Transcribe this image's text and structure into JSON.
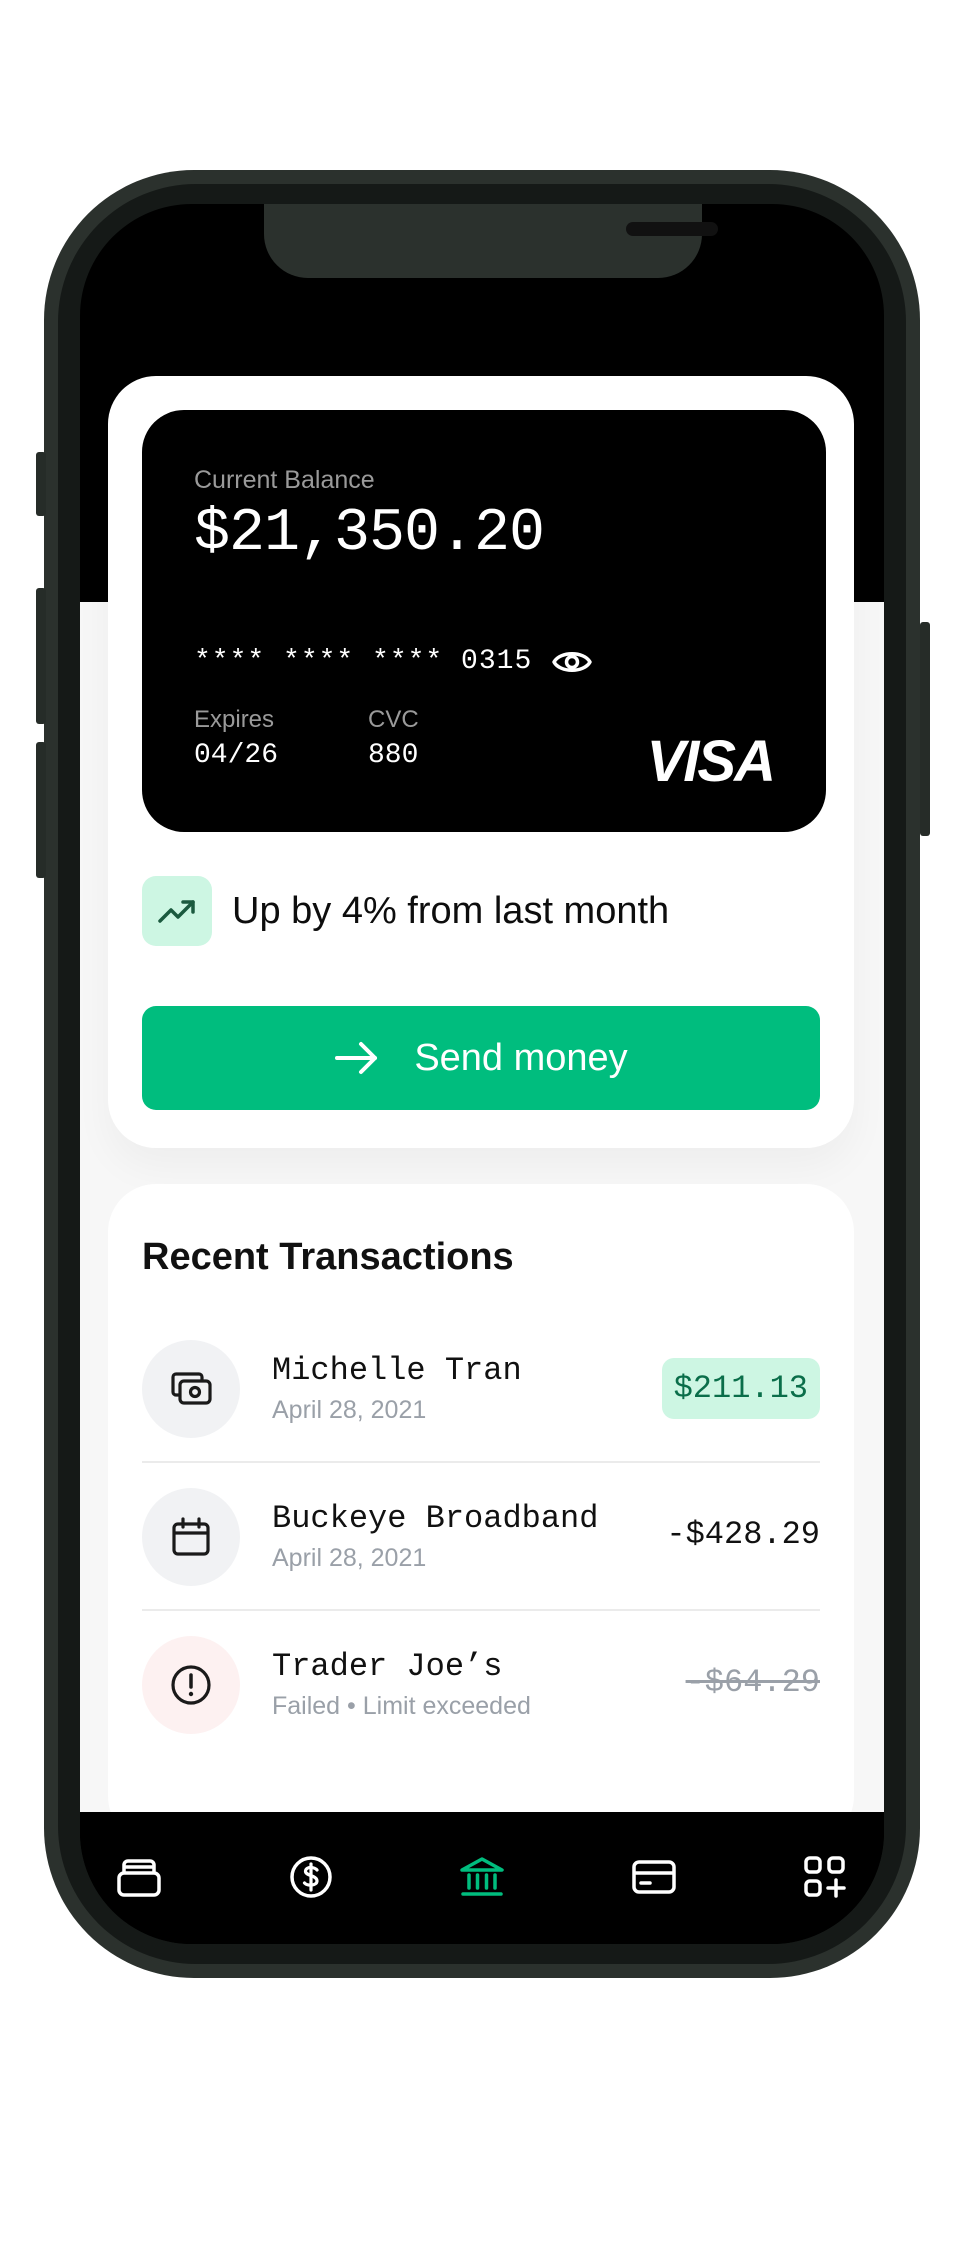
{
  "card": {
    "balance_label": "Current Balance",
    "balance": "$21,350.20",
    "number": "**** **** **** 0315",
    "expires_label": "Expires",
    "expires": "04/26",
    "cvc_label": "CVC",
    "cvc": "880",
    "brand": "VISA",
    "visibility_icon": "eye-icon"
  },
  "trend": {
    "icon": "trending-up-icon",
    "text": "Up by 4% from last month"
  },
  "send_button": {
    "icon": "arrow-right-icon",
    "label": "Send money"
  },
  "transactions": {
    "title": "Recent Transactions",
    "items": [
      {
        "icon": "cash-icon",
        "name": "Michelle Tran",
        "subtitle": "April 28, 2021",
        "amount": "$211.13",
        "status": "incoming"
      },
      {
        "icon": "calendar-icon",
        "name": "Buckeye Broadband",
        "subtitle": "April 28, 2021",
        "amount": "-$428.29",
        "status": "outgoing"
      },
      {
        "icon": "alert-icon",
        "name": "Trader Joe’s",
        "subtitle": "Failed • Limit exceeded",
        "amount": "-$64.29",
        "status": "failed"
      }
    ]
  },
  "nav": {
    "items": [
      {
        "icon": "wallet-icon",
        "active": false
      },
      {
        "icon": "dollar-icon",
        "active": false
      },
      {
        "icon": "bank-icon",
        "active": true
      },
      {
        "icon": "credit-card-icon",
        "active": false
      },
      {
        "icon": "apps-add-icon",
        "active": false
      }
    ]
  },
  "colors": {
    "accent": "#00bd7e",
    "accent_light": "#cdf6e3",
    "card": "#000000",
    "frame": "#2b312d"
  }
}
